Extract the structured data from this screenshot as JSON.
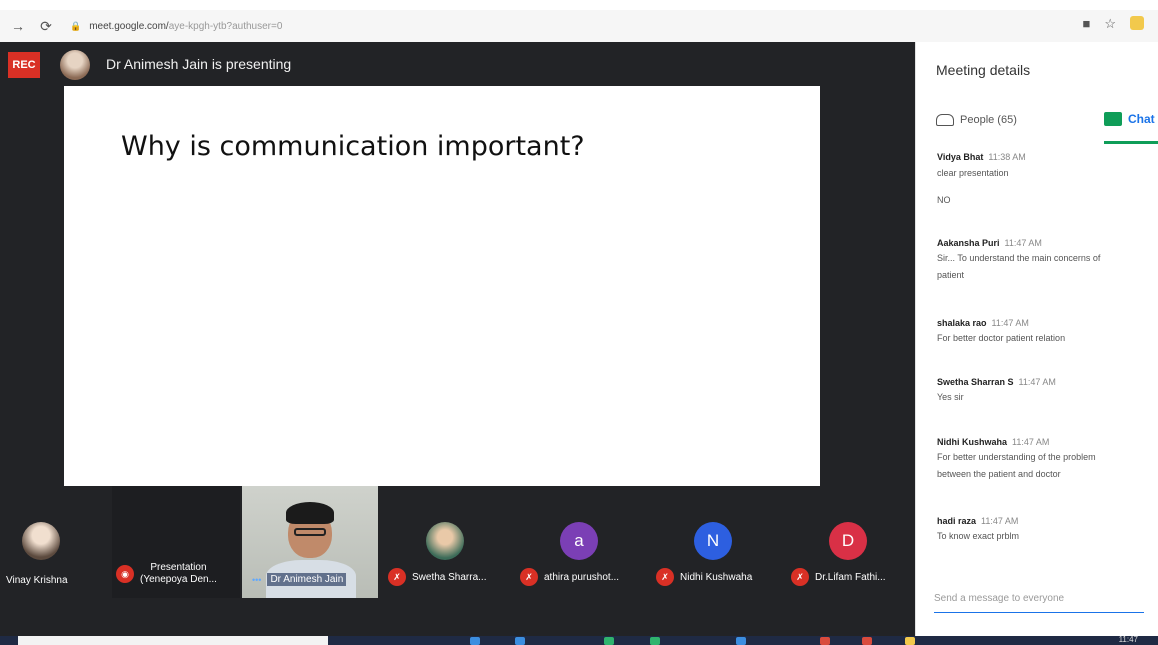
{
  "browser": {
    "url_host": "meet.google.com/",
    "url_rest": "aye-kpgh-ytb?authuser=0"
  },
  "meeting": {
    "rec_label": "REC",
    "presenter_text": "Dr Animesh Jain is presenting"
  },
  "slide": {
    "title": "Why is communication important?"
  },
  "tiles": [
    {
      "name": "Vinay Krishna",
      "muted": false,
      "avatar": "photo"
    },
    {
      "name": "Presentation\n(Yenepoya Den...",
      "muted": true,
      "avatar": "none"
    },
    {
      "name": "Dr Animesh Jain",
      "muted": false,
      "avatar": "camera"
    },
    {
      "name": "Swetha Sharra...",
      "muted": true,
      "avatar": "photo"
    },
    {
      "name": "athira purushot...",
      "muted": true,
      "avatar": "a",
      "color": "#7b3fb5"
    },
    {
      "name": "Nidhi Kushwaha",
      "muted": true,
      "avatar": "N",
      "color": "#2d5fe0"
    },
    {
      "name": "Dr.Lifam Fathi...",
      "muted": true,
      "avatar": "D",
      "color": "#d93046"
    }
  ],
  "panel": {
    "title": "Meeting details",
    "people_tab": "People (65)",
    "chat_tab": "Chat",
    "input_placeholder": "Send a message to everyone"
  },
  "messages": [
    {
      "sender": "Vidya Bhat",
      "time": "11:38 AM",
      "lines": [
        "clear presentation",
        "NO"
      ]
    },
    {
      "sender": "Aakansha Puri",
      "time": "11:47 AM",
      "lines": [
        "Sir... To understand the main concerns of",
        "patient"
      ]
    },
    {
      "sender": "shalaka rao",
      "time": "11:47 AM",
      "lines": [
        "For better doctor patient relation"
      ]
    },
    {
      "sender": "Swetha Sharran S",
      "time": "11:47 AM",
      "lines": [
        "Yes sir"
      ]
    },
    {
      "sender": "Nidhi Kushwaha",
      "time": "11:47 AM",
      "lines": [
        "For better understanding of the problem",
        "between the patient and doctor"
      ]
    },
    {
      "sender": "hadi raza",
      "time": "11:47 AM",
      "lines": [
        "To know exact prblm"
      ]
    }
  ],
  "taskbar": {
    "clock": "11:47"
  }
}
